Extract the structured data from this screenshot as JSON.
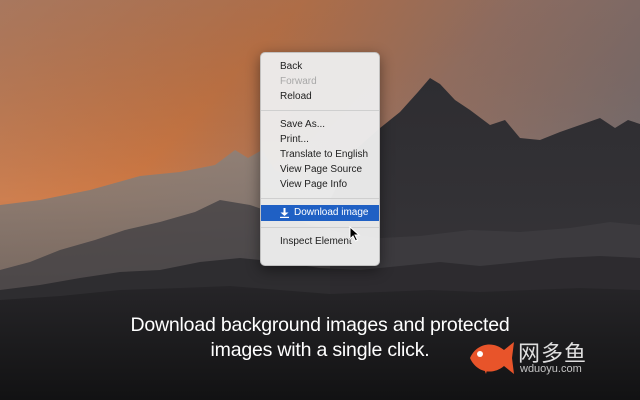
{
  "context_menu": {
    "items": [
      {
        "label": "Back"
      },
      {
        "label": "Forward"
      },
      {
        "label": "Reload"
      },
      {
        "label": "Save As..."
      },
      {
        "label": "Print..."
      },
      {
        "label": "Translate to English"
      },
      {
        "label": "View Page Source"
      },
      {
        "label": "View Page Info"
      },
      {
        "label": "Download image",
        "icon": "download-icon",
        "highlighted": true
      },
      {
        "label": "Inspect Element"
      }
    ]
  },
  "caption": {
    "line1": "Download background images and protected",
    "line2": "images with a single click."
  },
  "watermark": {
    "name": "网多鱼",
    "url": "wduoyu.com",
    "logo": "fish-logo"
  },
  "colors": {
    "highlight": "#1f60c4",
    "sky_orange": "#d9804a",
    "logo_orange": "#e8542a"
  }
}
